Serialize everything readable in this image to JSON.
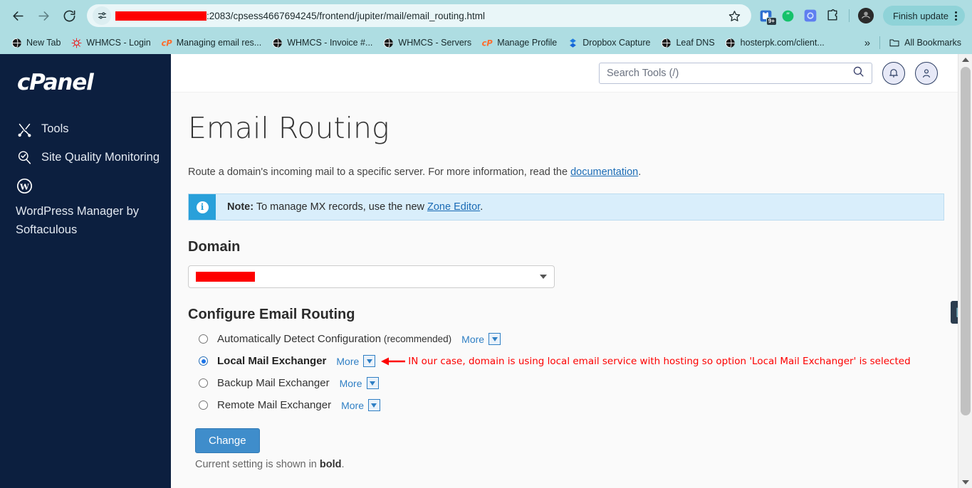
{
  "browser": {
    "nav": {
      "back": "back-arrow",
      "forward": "forward-arrow",
      "reload": "reload"
    },
    "url": {
      "redacted_host": "",
      "visible": ":2083/cpsess4667694245/frontend/jupiter/mail/email_routing.html"
    },
    "profile_button": "Finish update",
    "extensions": [
      {
        "name": "clipboard-extension-icon",
        "badge": "9+"
      },
      {
        "name": "grammarly-extension-icon",
        "badge": ""
      },
      {
        "name": "chatgpt-extension-icon",
        "badge": ""
      },
      {
        "name": "puzzle-extensions-icon",
        "badge": ""
      }
    ],
    "bookmarks": [
      {
        "label": "New Tab",
        "icon": "globe-icon"
      },
      {
        "label": "WHMCS - Login",
        "icon": "whmcs-icon"
      },
      {
        "label": "Managing email res...",
        "icon": "cpanel-icon"
      },
      {
        "label": "WHMCS - Invoice #...",
        "icon": "globe-icon"
      },
      {
        "label": "WHMCS - Servers",
        "icon": "globe-icon"
      },
      {
        "label": "Manage Profile",
        "icon": "cpanel-icon"
      },
      {
        "label": "Dropbox Capture",
        "icon": "dropbox-icon"
      },
      {
        "label": "Leaf DNS",
        "icon": "globe-icon"
      },
      {
        "label": "hosterpk.com/client...",
        "icon": "globe-icon"
      }
    ],
    "bookmarks_overflow": "»",
    "all_bookmarks": "All Bookmarks"
  },
  "sidebar": {
    "logo": "cPanel",
    "items": [
      {
        "label": "Tools",
        "icon": "tools-icon"
      },
      {
        "label": "Site Quality Monitoring",
        "icon": "magnifier-check-icon"
      },
      {
        "label": "WordPress Manager by Softaculous",
        "icon": "wordpress-icon"
      }
    ]
  },
  "topbar": {
    "search_placeholder": "Search Tools (/)",
    "notifications": "bell-icon",
    "account": "user-icon"
  },
  "main": {
    "title": "Email Routing",
    "intro_before": "Route a domain's incoming mail to a specific server. For more information, read the ",
    "intro_link": "documentation",
    "intro_after": ".",
    "note": {
      "label": "Note:",
      "text_before": " To manage MX records, use the new ",
      "link": "Zone Editor",
      "text_after": "."
    },
    "domain": {
      "heading": "Domain",
      "selected_value": "",
      "redacted": true
    },
    "configure": {
      "heading": "Configure Email Routing",
      "options": [
        {
          "label": "Automatically Detect Configuration",
          "suffix": " (recommended)",
          "selected": false,
          "more": "More"
        },
        {
          "label": "Local Mail Exchanger",
          "suffix": "",
          "selected": true,
          "more": "More"
        },
        {
          "label": "Backup Mail Exchanger",
          "suffix": "",
          "selected": false,
          "more": "More"
        },
        {
          "label": "Remote Mail Exchanger",
          "suffix": "",
          "selected": false,
          "more": "More"
        }
      ]
    },
    "annotation": "IN our case, domain is using local email service with hosting so option 'Local Mail Exchanger' is selected",
    "change_button": "Change",
    "current_setting_before": "Current setting is shown in ",
    "current_setting_bold": "bold",
    "current_setting_after": "."
  },
  "floating": {
    "chart_button": "chart-icon"
  },
  "colors": {
    "chrome_bg": "#aedde2",
    "sidebar_bg": "#0c1f3f",
    "accent_blue": "#3f8dcb",
    "link_blue": "#2f7fc4",
    "note_bg": "#d9eefb",
    "note_icon_bg": "#29a0da",
    "annotation_red": "#fd0000",
    "redaction_red": "#fe0000"
  }
}
